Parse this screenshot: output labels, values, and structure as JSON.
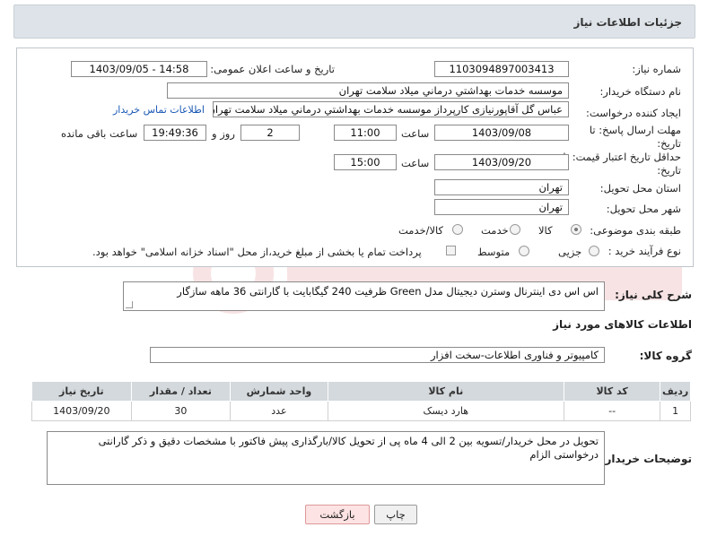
{
  "header": {
    "title": "جزئیات اطلاعات نیاز"
  },
  "fields": {
    "need_number_label": "شماره نیاز:",
    "need_number": "1103094897003413",
    "announce_label": "تاریخ و ساعت اعلان عمومی:",
    "announce_value": "1403/09/05 - 14:58",
    "buyer_org_label": "نام دستگاه خریدار:",
    "buyer_org": "موسسه خدمات بهداشتي درماني ميلاد سلامت تهران",
    "requester_label": "ایجاد کننده درخواست:",
    "requester": "عباس گل آقاپورنیازی کارپرداز موسسه خدمات بهداشتي درماني ميلاد سلامت تهران",
    "buyer_contact_link": "اطلاعات تماس خریدار",
    "deadline_label": "مهلت ارسال پاسخ: تا تاریخ:",
    "deadline_date": "1403/09/08",
    "time_label": "ساعت",
    "deadline_time": "11:00",
    "days_value": "2",
    "days_label": "روز و",
    "remaining_time": "19:49:36",
    "remaining_label": "ساعت باقی مانده",
    "validity_label": "حداقل تاریخ اعتبار قیمت: تا تاریخ:",
    "validity_date": "1403/09/20",
    "validity_time": "15:00",
    "province_label": "استان محل تحویل:",
    "province": "تهران",
    "city_label": "شهر محل تحویل:",
    "city": "تهران",
    "category_label": "طبقه بندی موضوعی:",
    "category_options": [
      "کالا",
      "خدمت",
      "کالا/خدمت"
    ],
    "process_label": "نوع فرآیند خرید :",
    "process_options": [
      "جزیی",
      "متوسط"
    ],
    "payment_note": "پرداخت تمام یا بخشی از مبلغ خرید،از محل \"اسناد خزانه اسلامی\" خواهد بود."
  },
  "description": {
    "label": "شرح کلی نیاز:",
    "text": "اس اس دی اینترنال وسترن دیجیتال مدل Green ظرفیت 240 گیگابایت با گارانتی 36 ماهه سازگار"
  },
  "goods": {
    "section_title": "اطلاعات کالاهای مورد نیاز",
    "group_label": "گروه کالا:",
    "group_value": "کامپیوتر و فناوری اطلاعات-سخت افزار",
    "columns": [
      "ردیف",
      "کد کالا",
      "نام کالا",
      "واحد شمارش",
      "تعداد / مقدار",
      "تاریخ نیاز"
    ],
    "rows": [
      [
        "1",
        "--",
        "هارد دیسک",
        "عدد",
        "30",
        "1403/09/20"
      ]
    ]
  },
  "buyer_notes": {
    "label": "توضیحات خریدار:",
    "text": "تحویل در محل خریدار/تسویه بین 2 الی 4 ماه پی از تحویل کالا/بارگذاری پیش فاکتور با مشخصات دقیق و ذکر گارانتی درخواستی الزام"
  },
  "buttons": {
    "print": "چاپ",
    "back": "بازگشت"
  },
  "watermark": {
    "color": "#c8232c"
  }
}
